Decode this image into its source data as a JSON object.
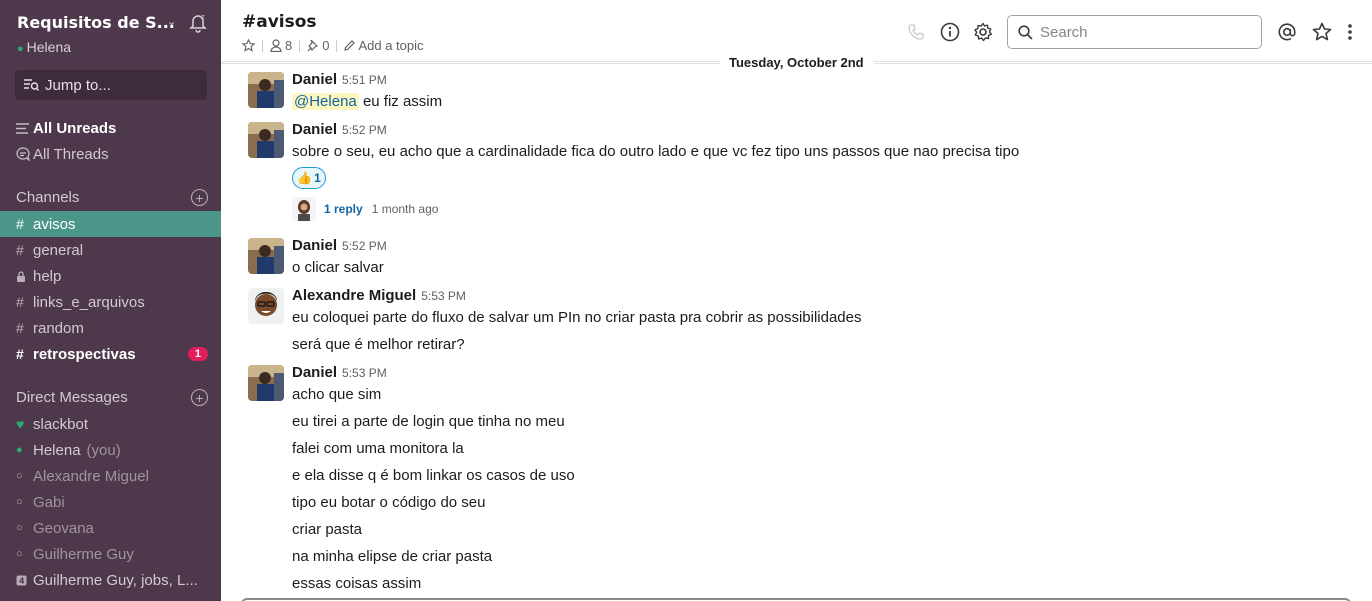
{
  "workspace": {
    "name": "Requisitos de S...",
    "user": "Helena"
  },
  "sidebar": {
    "jump_placeholder": "Jump to...",
    "all_unreads": "All Unreads",
    "all_threads": "All Threads",
    "channels_header": "Channels",
    "channels": [
      {
        "name": "avisos",
        "state": "active"
      },
      {
        "name": "general",
        "state": "normal"
      },
      {
        "name": "help",
        "state": "private"
      },
      {
        "name": "links_e_arquivos",
        "state": "normal"
      },
      {
        "name": "random",
        "state": "normal"
      },
      {
        "name": "retrospectivas",
        "state": "unread",
        "badge": "1"
      }
    ],
    "dm_header": "Direct Messages",
    "dms": [
      {
        "name": "slackbot",
        "status": "heart"
      },
      {
        "name": "Helena",
        "suffix": "(you)",
        "status": "online"
      },
      {
        "name": "Alexandre Miguel",
        "status": "away"
      },
      {
        "name": "Gabi",
        "status": "away"
      },
      {
        "name": "Geovana",
        "status": "away"
      },
      {
        "name": "Guilherme Guy",
        "status": "away"
      },
      {
        "name": "Guilherme Guy, jobs, L...",
        "status": "group"
      }
    ]
  },
  "header": {
    "channel": "#avisos",
    "members": "8",
    "pins": "0",
    "add_topic": "Add a topic",
    "search_placeholder": "Search"
  },
  "day_divider": "Tuesday, October 2nd",
  "messages": [
    {
      "author": "Daniel",
      "time": "5:51 PM",
      "mention": "@Helena",
      "lines": [
        "eu fiz assim"
      ]
    },
    {
      "author": "Daniel",
      "time": "5:52 PM",
      "lines": [
        "sobre o seu, eu acho que a cardinalidade fica do outro lado e que vc fez tipo uns passos que nao precisa tipo"
      ],
      "reaction": {
        "emoji": "👍",
        "count": "1"
      },
      "thread": {
        "replies": "1 reply",
        "when": "1 month ago"
      }
    },
    {
      "author": "Daniel",
      "time": "5:52 PM",
      "lines": [
        "o clicar salvar"
      ]
    },
    {
      "author": "Alexandre Miguel",
      "time": "5:53 PM",
      "lines": [
        "eu coloquei parte do fluxo de salvar um PIn no criar pasta pra cobrir as possibilidades",
        "será que é melhor retirar?"
      ]
    },
    {
      "author": "Daniel",
      "time": "5:53 PM",
      "lines": [
        "acho que sim",
        "eu tirei a parte de login que tinha no meu",
        "falei com uma monitora la",
        "e ela disse q é bom linkar os casos de uso",
        "tipo eu botar o código do seu",
        "criar pasta",
        "na minha elipse de criar pasta",
        "essas coisas assim"
      ]
    }
  ],
  "colors": {
    "sidebar_bg": "#4d394b",
    "active_channel": "#4c9689",
    "badge": "#e01e5a",
    "link": "#1264a3"
  }
}
